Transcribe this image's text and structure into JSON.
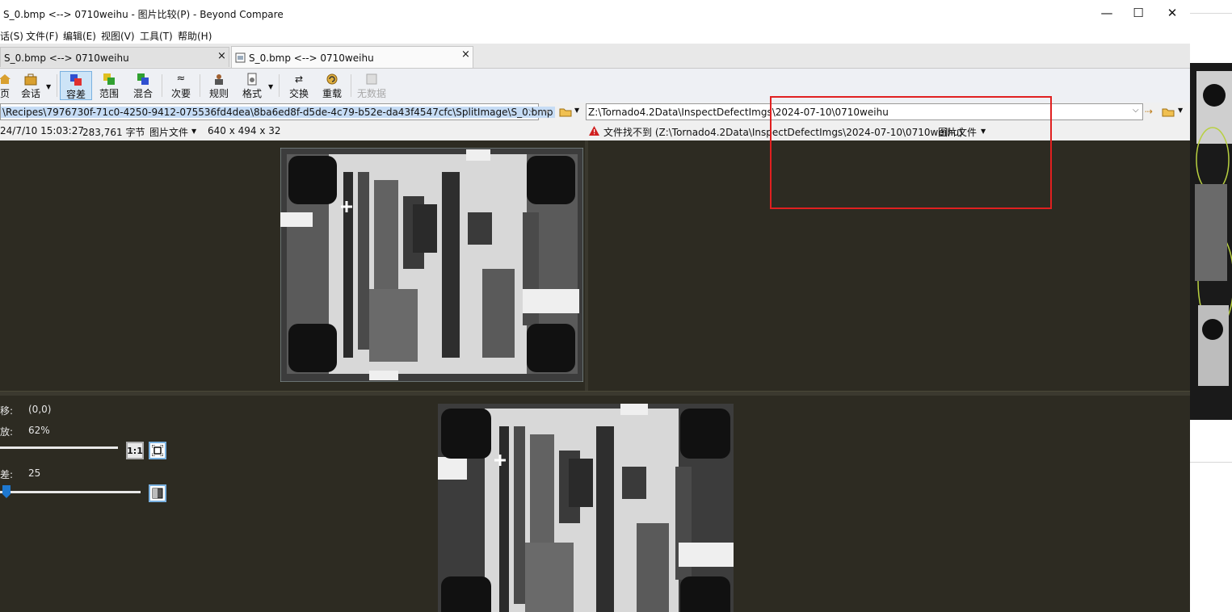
{
  "window": {
    "title": "S_0.bmp <--> 0710weihu - 图片比较(P) - Beyond Compare",
    "minimize": "—",
    "maximize": "☐",
    "close": "✕"
  },
  "menu": [
    "话(S)",
    "文件(F)",
    "编辑(E)",
    "视图(V)",
    "工具(T)",
    "帮助(H)"
  ],
  "tabs": [
    {
      "label": "S_0.bmp <--> 0710weihu",
      "close": "×"
    },
    {
      "label": "S_0.bmp <--> 0710weihu",
      "close": "×"
    }
  ],
  "toolbar": {
    "home": "页",
    "session": "会话",
    "diff": "容差",
    "range": "范围",
    "blend": "混合",
    "minor": "次要",
    "rules": "规则",
    "format": "格式",
    "swap": "交换",
    "reload": "重载",
    "nodata": "无数据"
  },
  "left_path": "\\Recipes\\7976730f-71c0-4250-9412-075536fd4dea\\8ba6ed8f-d5de-4c79-b52e-da43f4547cfc\\SplitImage\\S_0.bmp",
  "right_path": "Z:\\Tornado4.2Data\\InspectDefectImgs\\2024-07-10\\0710weihu",
  "left_info": {
    "datetime": "24/7/10 15:03:27",
    "size": "283,761 字节",
    "filetype": "图片文件",
    "dims": "640 x 494 x 32"
  },
  "right_info": {
    "warning": "文件找不到 (Z:\\Tornado4.2Data\\InspectDefectImgs\\2024-07-10\\0710weihu)",
    "filetype": "图片文件"
  },
  "controls": {
    "offset_label": "移:",
    "offset_value": "(0,0)",
    "zoom_label": "放:",
    "zoom_value": "62%",
    "zoom_1to1": "1:1",
    "tolerance_label": "差:",
    "tolerance_value": "25"
  },
  "colors": {
    "view_bg": "#2d2b22",
    "highlight_box": "#e02020",
    "selection": "#c6dcf5"
  }
}
